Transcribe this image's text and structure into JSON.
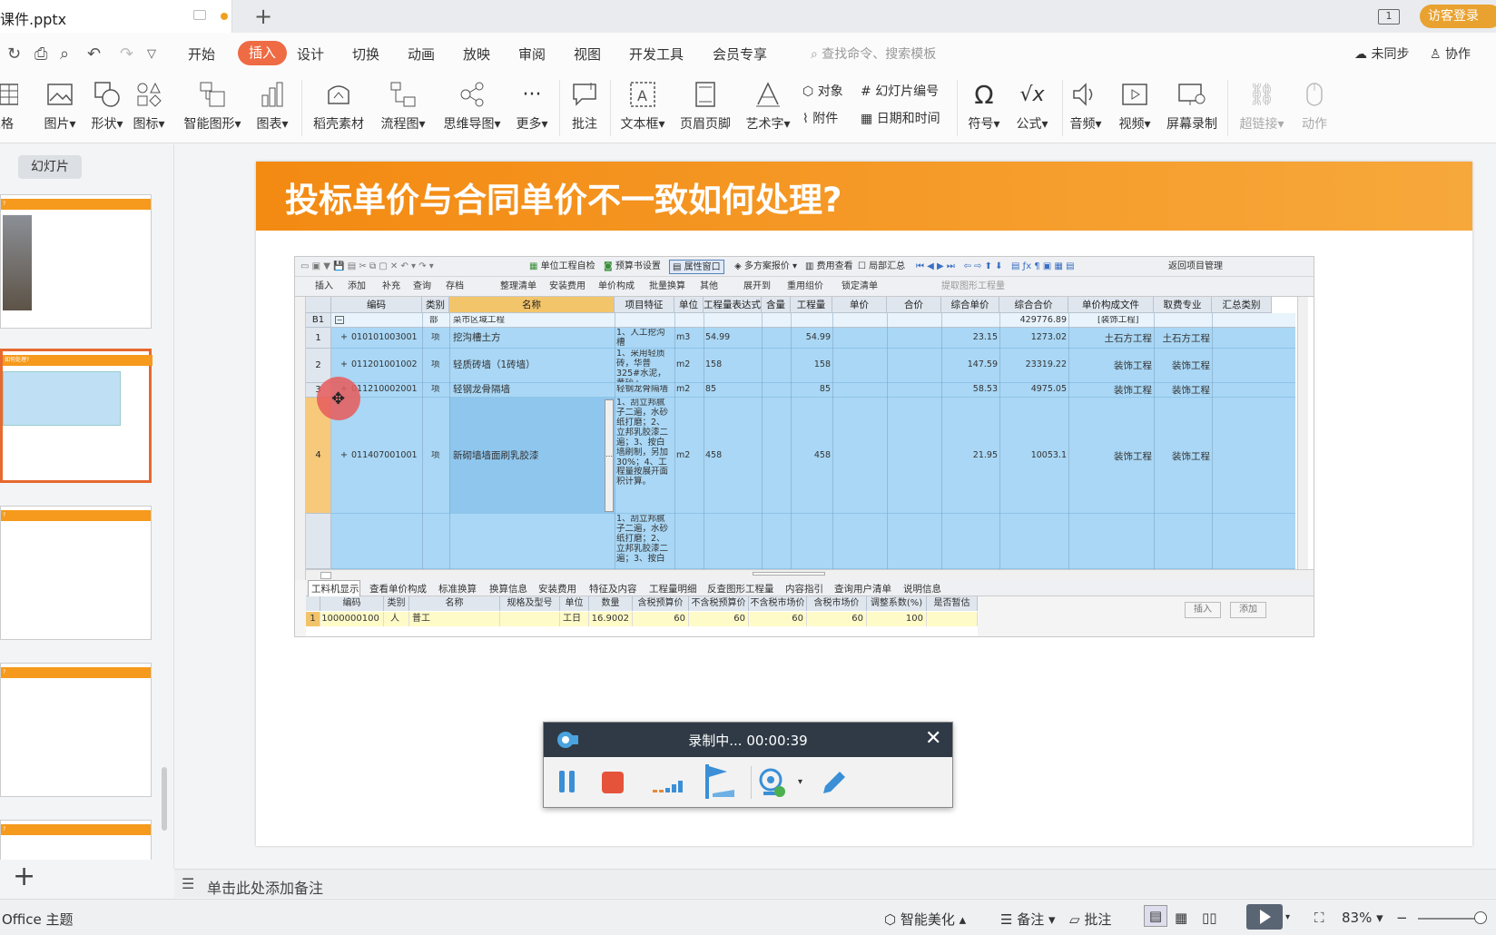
{
  "titlebar": {
    "file_tab": "课件.pptx",
    "login": "访客登录",
    "window_btn": "1"
  },
  "menubar": {
    "items": [
      "开始",
      "插入",
      "设计",
      "切换",
      "动画",
      "放映",
      "审阅",
      "视图",
      "开发工具",
      "会员专享"
    ],
    "active": "插入",
    "search_placeholder": "查找命令、搜索模板",
    "sync": "未同步",
    "collab": "协作"
  },
  "ribbon": {
    "buttons": [
      "表格",
      "图片",
      "形状",
      "图标",
      "智能图形",
      "图表",
      "稻壳素材",
      "流程图",
      "思维导图",
      "更多",
      "批注",
      "文本框",
      "页眉页脚",
      "艺术字",
      "符号",
      "公式",
      "音频",
      "视频",
      "屏幕录制",
      "超链接",
      "动作"
    ],
    "small": [
      "对象",
      "幻灯片编号",
      "附件",
      "日期和时间"
    ]
  },
  "leftpane": {
    "tab_label": "幻灯片",
    "thumb_titles": [
      "?",
      "如何处理?",
      "?",
      "?",
      "?"
    ]
  },
  "slide": {
    "title": "投标单价与合同单价不一致如何处理?"
  },
  "software": {
    "toolbar1": [
      "单位工程自检",
      "预算书设置",
      "属性窗口",
      "多方案报价",
      "费用查看",
      "局部汇总",
      "返回项目管理"
    ],
    "toolbar2": [
      "插入",
      "添加",
      "补充",
      "查询",
      "存档",
      "整理清单",
      "安装费用",
      "单价构成",
      "批量换算",
      "其他",
      "展开到",
      "重用组价",
      "锁定清单",
      "提取图形工程量"
    ],
    "headers": [
      "编码",
      "类别",
      "名称",
      "项目特征",
      "单位",
      "工程量表达式",
      "含量",
      "工程量",
      "单价",
      "合价",
      "综合单价",
      "综合合价",
      "单价构成文件",
      "取费专业",
      "汇总类别"
    ],
    "section": {
      "no": "B1",
      "type": "部",
      "name": "菜市区域工程",
      "total": "429776.89",
      "file": "[装饰工程]"
    },
    "rows": [
      {
        "no": "1",
        "code": "010101003001",
        "type": "项",
        "name": "挖沟槽土方",
        "feature": "1、人工挖沟槽",
        "unit": "m3",
        "expr": "54.99",
        "qty": "54.99",
        "uprice": "23.15",
        "total": "1273.02",
        "file": "土石方工程",
        "major": "土石方工程"
      },
      {
        "no": "2",
        "code": "011201001002",
        "type": "项",
        "name": "轻质砖墙（1砖墙）",
        "feature": "1、采用轻质砖，华普325#水泥，黄砂+",
        "unit": "m2",
        "expr": "158",
        "qty": "158",
        "uprice": "147.59",
        "total": "23319.22",
        "file": "装饰工程",
        "major": "装饰工程"
      },
      {
        "no": "3",
        "code": "011210002001",
        "type": "项",
        "name": "轻钢龙骨隔墙",
        "feature": "轻钢龙骨隔墙",
        "unit": "m2",
        "expr": "85",
        "qty": "85",
        "uprice": "58.53",
        "total": "4975.05",
        "file": "装饰工程",
        "major": "装饰工程"
      },
      {
        "no": "4",
        "code": "011407001001",
        "type": "项",
        "name": "新砌墙墙面刷乳胶漆",
        "feature": "1、刮立邦腻子二遍，水砂纸打磨；2、立邦乳胶漆二遍；3、按白墙刷制，另加30%；4、工程量按展开面积计算。",
        "unit": "m2",
        "expr": "458",
        "qty": "458",
        "uprice": "21.95",
        "total": "10053.1",
        "file": "装饰工程",
        "major": "装饰工程"
      }
    ],
    "row5_feature": "1、刮立邦腻子二遍，水砂纸打磨；2、立邦乳胶漆二遍；3、按白",
    "bottom_tabs": [
      "工料机显示",
      "查看单价构成",
      "标准换算",
      "换算信息",
      "安装费用",
      "特征及内容",
      "工程量明细",
      "反查图形工程量",
      "内容指引",
      "查询用户清单",
      "说明信息"
    ],
    "sub_headers": [
      "编码",
      "类别",
      "名称",
      "规格及型号",
      "单位",
      "数量",
      "含税预算价",
      "不含税预算价",
      "不含税市场价",
      "含税市场价",
      "调整系数(%)",
      "是否暂估"
    ],
    "sub_row": {
      "no": "1",
      "code": "1000000100",
      "type": "人",
      "name": "普工",
      "unit": "工日",
      "qty": "16.9002",
      "p1": "60",
      "p2": "60",
      "p3": "60",
      "p4": "60",
      "ratio": "100"
    },
    "side_buttons": [
      "插入",
      "添加"
    ]
  },
  "recorder": {
    "title": "录制中... 00:00:39"
  },
  "notes": {
    "placeholder": "单击此处添加备注"
  },
  "status": {
    "theme": "Office 主题",
    "beautify": "智能美化",
    "notes": "备注",
    "comment": "批注",
    "zoom": "83%"
  }
}
